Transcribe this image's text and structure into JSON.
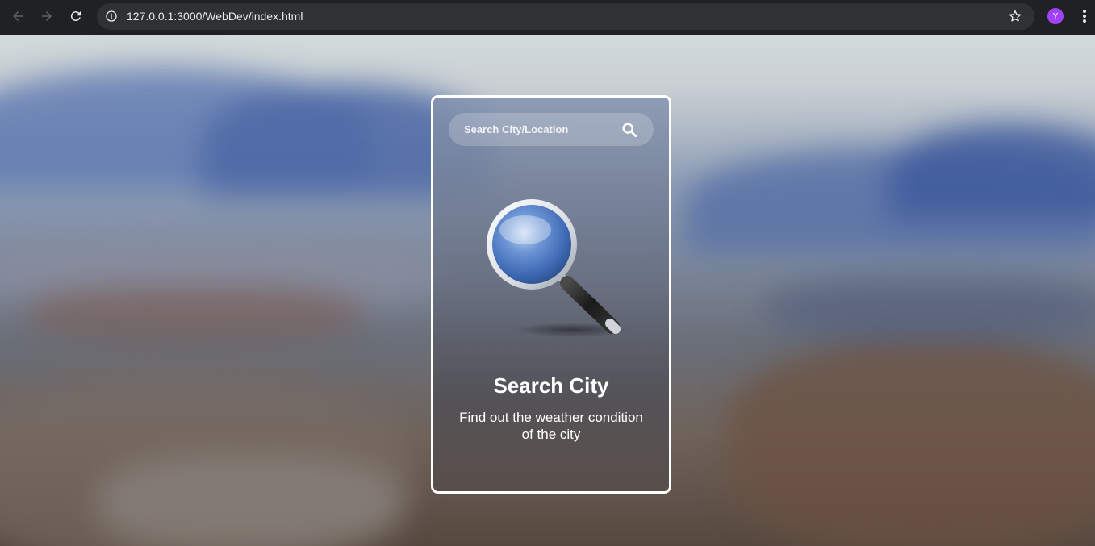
{
  "browser": {
    "url": "127.0.0.1:3000/WebDev/index.html",
    "profile_initial": "Y",
    "profile_color": "#a142f4",
    "icons": {
      "back": "arrow-left-icon",
      "forward": "arrow-right-icon",
      "reload": "reload-icon",
      "info": "info-icon",
      "bookmark": "star-icon",
      "menu": "kebab-menu-icon"
    }
  },
  "page": {
    "search": {
      "placeholder": "Search City/Location",
      "value": "",
      "button_icon": "search-icon"
    },
    "illustration_icon": "magnifying-glass-icon",
    "title": "Search City",
    "subtitle": "Find out the weather condition of the city"
  },
  "colors": {
    "card_border": "#ffffff",
    "text": "#ffffff",
    "lens_blue": "#4a78c0"
  }
}
